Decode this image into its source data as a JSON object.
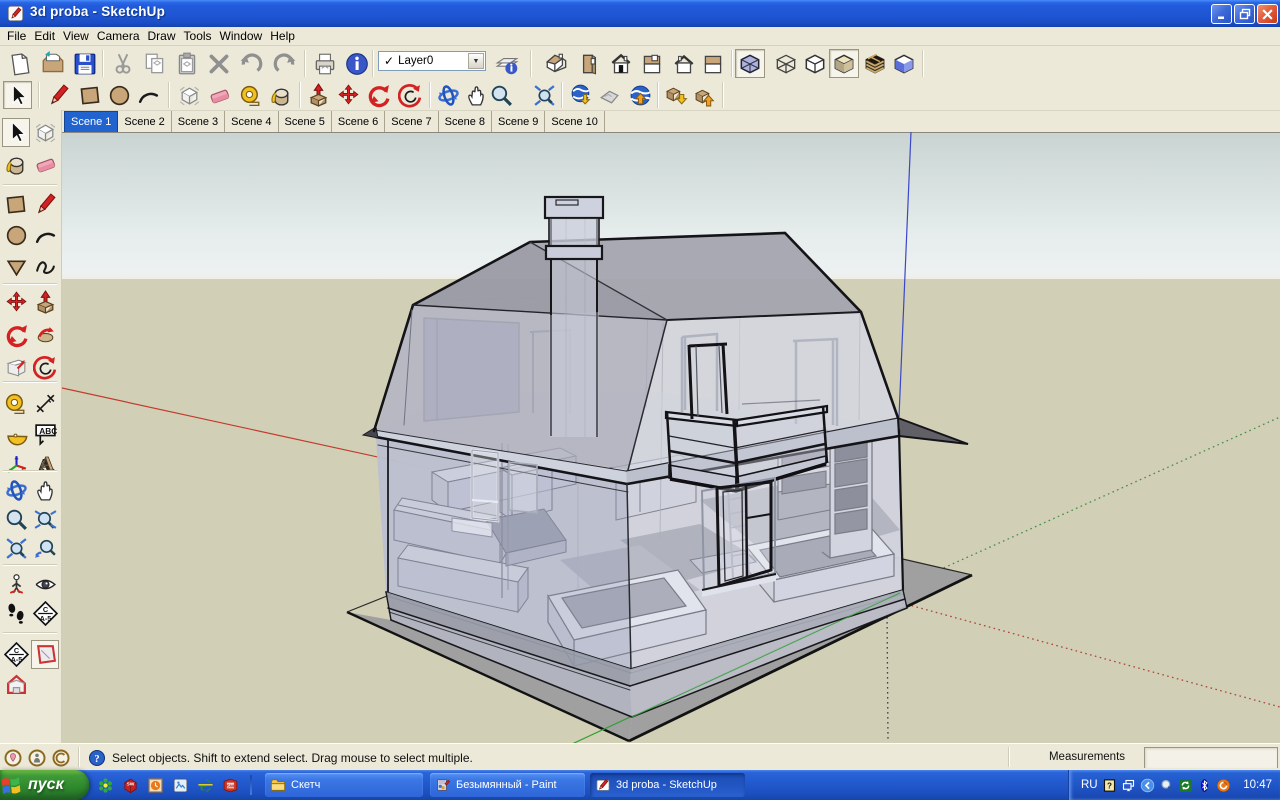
{
  "window": {
    "title": "3d proba - SketchUp",
    "controls": {
      "minimize": "minimize",
      "restore": "restore",
      "close": "close"
    }
  },
  "menu": {
    "items": [
      "File",
      "Edit",
      "View",
      "Camera",
      "Draw",
      "Tools",
      "Window",
      "Help"
    ]
  },
  "toolbar_standard": {
    "buttons": [
      {
        "name": "new-document"
      },
      {
        "name": "open-folder"
      },
      {
        "name": "save-floppy"
      },
      {
        "name": "cut-scissors"
      },
      {
        "name": "copy-pages"
      },
      {
        "name": "paste-clipboard"
      },
      {
        "name": "erase-x"
      },
      {
        "name": "undo-arrow"
      },
      {
        "name": "redo-arrow"
      },
      {
        "name": "print-printer"
      },
      {
        "name": "model-info"
      },
      {
        "name": "layers-manager"
      },
      {
        "name": "view-iso"
      },
      {
        "name": "view-top"
      },
      {
        "name": "view-front"
      },
      {
        "name": "view-back"
      },
      {
        "name": "view-left"
      },
      {
        "name": "view-right"
      },
      {
        "name": "style-xray",
        "pressed": true
      },
      {
        "name": "style-wireframe"
      },
      {
        "name": "style-hiddenline"
      },
      {
        "name": "style-shaded",
        "pressed": true
      },
      {
        "name": "style-textured"
      },
      {
        "name": "style-monochrome"
      }
    ],
    "layer_combo": {
      "checkmark": "✓",
      "value": "Layer0",
      "dropdown": "▼"
    }
  },
  "toolbar_drawing": {
    "buttons": [
      {
        "name": "select-arrow",
        "pressed": true
      },
      {
        "name": "line-pencil"
      },
      {
        "name": "rectangle-tool"
      },
      {
        "name": "circle-tool"
      },
      {
        "name": "arc-tool"
      },
      {
        "name": "make-component"
      },
      {
        "name": "eraser-tool"
      },
      {
        "name": "tape-measure"
      },
      {
        "name": "paint-bucket"
      },
      {
        "name": "push-pull"
      },
      {
        "name": "move-tool"
      },
      {
        "name": "rotate-tool"
      },
      {
        "name": "offset-tool"
      },
      {
        "name": "orbit-tool"
      },
      {
        "name": "pan-tool"
      },
      {
        "name": "zoom-tool"
      },
      {
        "name": "zoom-extents"
      },
      {
        "name": "ge-get-view"
      },
      {
        "name": "ge-terrain"
      },
      {
        "name": "ge-place-model"
      },
      {
        "name": "get-models"
      },
      {
        "name": "share-models"
      }
    ]
  },
  "scene_tabs": {
    "active": "Scene 1",
    "tabs": [
      "Scene 1",
      "Scene 2",
      "Scene 3",
      "Scene 4",
      "Scene 5",
      "Scene 6",
      "Scene 7",
      "Scene 8",
      "Scene 9",
      "Scene 10"
    ]
  },
  "left_dock": {
    "rows": [
      [
        "select-arrow|pressed",
        "make-component"
      ],
      [
        "paint-bucket",
        "eraser-tool"
      ],
      [
        "rectangle-tool",
        "line-pencil"
      ],
      [
        "circle-tool",
        "arc-tool"
      ],
      [
        "polygon-tool",
        "freehand-tool"
      ],
      [
        "move-tool",
        "push-pull"
      ],
      [
        "rotate-tool",
        "follow-me"
      ],
      [
        "scale-tool",
        "offset-tool"
      ],
      [
        "tape-measure",
        "dimension-tool"
      ],
      [
        "protractor-tool",
        "text-tool"
      ],
      [
        "axes-tool",
        "text3d-tool"
      ],
      [
        "orbit-tool",
        "pan-tool"
      ],
      [
        "zoom-tool",
        "zoom-window"
      ],
      [
        "zoom-extents",
        "zoom-previous"
      ],
      [
        "position-camera",
        "look-around"
      ],
      [
        "walk-tool",
        "ca5-diamond"
      ],
      [
        "ca5-diamond",
        "section-plane|pressed"
      ],
      [
        "section-house",
        ""
      ]
    ]
  },
  "statusbar": {
    "icons": [
      "status-geo",
      "status-person",
      "status-claim"
    ],
    "help_icon": "help-circle",
    "hint": "Select objects. Shift to extend select. Drag mouse to select multiple.",
    "measurements_label": "Measurements",
    "measurements_value": ""
  },
  "taskbar": {
    "start_label": "пуск",
    "quick_launch": [
      "q-flower",
      "q-sw",
      "q-clock",
      "q-app",
      "q-ie",
      "q-sw2"
    ],
    "tasks": [
      {
        "label": "Скетч",
        "icon": "folder-task",
        "active": false
      },
      {
        "label": "Безымянный - Paint",
        "icon": "paint-task",
        "active": false
      },
      {
        "label": "3d proba - SketchUp",
        "icon": "sketchup-task",
        "active": true
      }
    ],
    "tray": {
      "language": "RU",
      "icons": [
        "tray-help",
        "tray-window",
        "tray-hide",
        "tray-magnifier",
        "tray-green",
        "tray-bt",
        "tray-orange"
      ],
      "time": "10:47"
    }
  },
  "viewport": {
    "model": "3d house x-ray",
    "colors": {
      "sky_top": "#cbdcdd",
      "sky_horizon": "#eef2ef",
      "ground": "#d6d2b4",
      "axis_red": "#c23b2e",
      "axis_green": "#3a9a3a",
      "axis_blue": "#3947c8"
    }
  }
}
